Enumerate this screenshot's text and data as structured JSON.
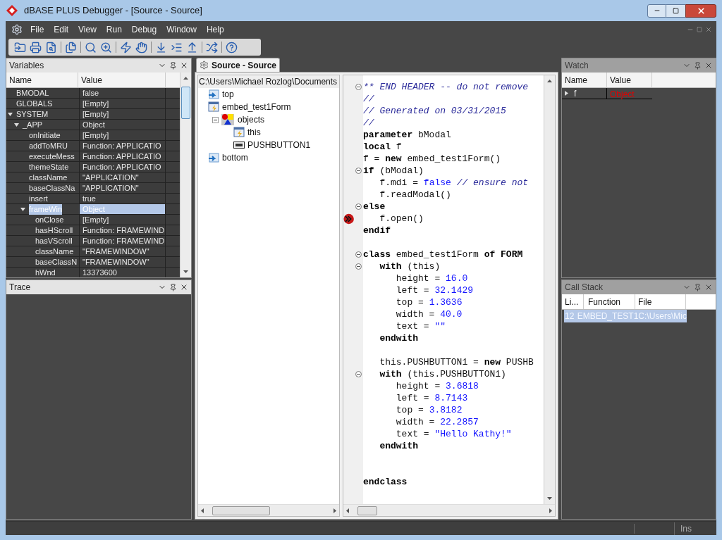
{
  "window": {
    "title": "dBASE PLUS Debugger - [Source - Source]"
  },
  "menu": [
    "File",
    "Edit",
    "View",
    "Run",
    "Debug",
    "Window",
    "Help"
  ],
  "variables": {
    "title": "Variables",
    "active": true,
    "columns": [
      "Name",
      "Value"
    ],
    "rows": [
      {
        "name": "BMODAL",
        "value": "false",
        "selected": false
      },
      {
        "name": "GLOBALS",
        "value": "[Empty]",
        "selected": false
      },
      {
        "name": "SYSTEM",
        "value": "[Empty]",
        "selected": false,
        "expanded": true,
        "children": [
          {
            "name": "_APP",
            "value": "Object",
            "selected": false,
            "expanded": true,
            "children": [
              {
                "name": "onInitiate",
                "value": "[Empty]",
                "selected": false
              },
              {
                "name": "addToMRU",
                "value": "Function: APPLICATIO",
                "selected": false
              },
              {
                "name": "executeMess",
                "value": "Function: APPLICATIO",
                "selected": false
              },
              {
                "name": "themeState",
                "value": "Function: APPLICATIO",
                "selected": false
              },
              {
                "name": "className",
                "value": "\"APPLICATION\"",
                "selected": false
              },
              {
                "name": "baseClassNa",
                "value": "\"APPLICATION\"",
                "selected": false
              },
              {
                "name": "insert",
                "value": "true",
                "selected": false
              },
              {
                "name": "frameWin",
                "value": "Object",
                "selected": true,
                "expanded": true,
                "children": [
                  {
                    "name": "onClose",
                    "value": "[Empty]",
                    "selected": false
                  },
                  {
                    "name": "hasHScroll",
                    "value": "Function: FRAMEWIND",
                    "selected": false
                  },
                  {
                    "name": "hasVScroll",
                    "value": "Function: FRAMEWIND",
                    "selected": false
                  },
                  {
                    "name": "className",
                    "value": "\"FRAMEWINDOW\"",
                    "selected": false
                  },
                  {
                    "name": "baseClassN",
                    "value": "\"FRAMEWINDOW\"",
                    "selected": false
                  },
                  {
                    "name": "hWnd",
                    "value": "13373600",
                    "selected": false
                  }
                ]
              }
            ]
          }
        ]
      }
    ]
  },
  "trace": {
    "title": "Trace",
    "active": true
  },
  "source": {
    "tab": "Source - Source",
    "path": "C:\\Users\\Michael Rozlog\\Documents",
    "tree": [
      {
        "kind": "page",
        "label": "top"
      },
      {
        "kind": "form",
        "label": "embed_test1Form",
        "children": [
          {
            "kind": "shapes",
            "label": "objects",
            "expanded": true,
            "children": [
              {
                "kind": "form",
                "label": "this"
              },
              {
                "kind": "button",
                "label": "PUSHBUTTON1"
              }
            ]
          }
        ]
      },
      {
        "kind": "page",
        "label": "bottom"
      }
    ],
    "code": [
      {
        "fold": true,
        "current": false,
        "segments": [
          {
            "kind": "comment",
            "text": "** END HEADER -- do not remove"
          }
        ]
      },
      {
        "fold": false,
        "current": false,
        "segments": [
          {
            "kind": "comment",
            "text": "//"
          }
        ]
      },
      {
        "fold": false,
        "current": false,
        "segments": [
          {
            "kind": "comment",
            "text": "// Generated on 03/31/2015"
          }
        ]
      },
      {
        "fold": false,
        "current": false,
        "segments": [
          {
            "kind": "comment",
            "text": "//"
          }
        ]
      },
      {
        "fold": false,
        "current": false,
        "segments": [
          {
            "kind": "keyword",
            "text": "parameter"
          },
          {
            "kind": "plain",
            "text": " bModal"
          }
        ]
      },
      {
        "fold": false,
        "current": false,
        "segments": [
          {
            "kind": "keyword",
            "text": "local"
          },
          {
            "kind": "plain",
            "text": " f"
          }
        ]
      },
      {
        "fold": false,
        "current": false,
        "segments": [
          {
            "kind": "plain",
            "text": "f = "
          },
          {
            "kind": "keyword",
            "text": "new"
          },
          {
            "kind": "plain",
            "text": " embed_test1Form()"
          }
        ]
      },
      {
        "fold": true,
        "current": false,
        "segments": [
          {
            "kind": "keyword",
            "text": "if"
          },
          {
            "kind": "plain",
            "text": " (bModal)"
          }
        ]
      },
      {
        "fold": false,
        "current": false,
        "segments": [
          {
            "kind": "plain",
            "text": "   f.mdi = "
          },
          {
            "kind": "literal",
            "text": "false"
          },
          {
            "kind": "comment",
            "text": " // ensure not"
          }
        ]
      },
      {
        "fold": false,
        "current": false,
        "segments": [
          {
            "kind": "plain",
            "text": "   f.readModal()"
          }
        ]
      },
      {
        "fold": true,
        "current": false,
        "segments": [
          {
            "kind": "keyword",
            "text": "else"
          }
        ]
      },
      {
        "fold": false,
        "current": true,
        "segments": [
          {
            "kind": "plain",
            "text": "   f.open()"
          }
        ]
      },
      {
        "fold": false,
        "current": false,
        "segments": [
          {
            "kind": "keyword",
            "text": "endif"
          }
        ]
      },
      {
        "kind": "blank"
      },
      {
        "fold": true,
        "current": false,
        "segments": [
          {
            "kind": "keyword",
            "text": "class"
          },
          {
            "kind": "plain",
            "text": " embed_test1Form "
          },
          {
            "kind": "keyword",
            "text": "of FORM"
          }
        ]
      },
      {
        "fold": true,
        "current": false,
        "segments": [
          {
            "kind": "keyword",
            "text": "   with"
          },
          {
            "kind": "plain",
            "text": " (this)"
          }
        ]
      },
      {
        "fold": false,
        "current": false,
        "segments": [
          {
            "kind": "plain",
            "text": "      height = "
          },
          {
            "kind": "literal",
            "text": "16.0"
          }
        ]
      },
      {
        "fold": false,
        "current": false,
        "segments": [
          {
            "kind": "plain",
            "text": "      left = "
          },
          {
            "kind": "literal",
            "text": "32.1429"
          }
        ]
      },
      {
        "fold": false,
        "current": false,
        "segments": [
          {
            "kind": "plain",
            "text": "      top = "
          },
          {
            "kind": "literal",
            "text": "1.3636"
          }
        ]
      },
      {
        "fold": false,
        "current": false,
        "segments": [
          {
            "kind": "plain",
            "text": "      width = "
          },
          {
            "kind": "literal",
            "text": "40.0"
          }
        ]
      },
      {
        "fold": false,
        "current": false,
        "segments": [
          {
            "kind": "plain",
            "text": "      text = "
          },
          {
            "kind": "literal",
            "text": "\"\""
          }
        ]
      },
      {
        "fold": false,
        "current": false,
        "segments": [
          {
            "kind": "keyword",
            "text": "   endwith"
          }
        ]
      },
      {
        "kind": "blank"
      },
      {
        "fold": false,
        "current": false,
        "segments": [
          {
            "kind": "plain",
            "text": "   this.PUSHBUTTON1 = "
          },
          {
            "kind": "keyword",
            "text": "new"
          },
          {
            "kind": "plain",
            "text": " PUSHB"
          }
        ]
      },
      {
        "fold": true,
        "current": false,
        "segments": [
          {
            "kind": "keyword",
            "text": "   with"
          },
          {
            "kind": "plain",
            "text": " (this.PUSHBUTTON1)"
          }
        ]
      },
      {
        "fold": false,
        "current": false,
        "segments": [
          {
            "kind": "plain",
            "text": "      height = "
          },
          {
            "kind": "literal",
            "text": "3.6818"
          }
        ]
      },
      {
        "fold": false,
        "current": false,
        "segments": [
          {
            "kind": "plain",
            "text": "      left = "
          },
          {
            "kind": "literal",
            "text": "8.7143"
          }
        ]
      },
      {
        "fold": false,
        "current": false,
        "segments": [
          {
            "kind": "plain",
            "text": "      top = "
          },
          {
            "kind": "literal",
            "text": "3.8182"
          }
        ]
      },
      {
        "fold": false,
        "current": false,
        "segments": [
          {
            "kind": "plain",
            "text": "      width = "
          },
          {
            "kind": "literal",
            "text": "22.2857"
          }
        ]
      },
      {
        "fold": false,
        "current": false,
        "segments": [
          {
            "kind": "plain",
            "text": "      text = "
          },
          {
            "kind": "literal",
            "text": "\"Hello Kathy!\""
          }
        ]
      },
      {
        "fold": false,
        "current": false,
        "segments": [
          {
            "kind": "keyword",
            "text": "   endwith"
          }
        ]
      },
      {
        "kind": "blank"
      },
      {
        "kind": "blank"
      },
      {
        "fold": false,
        "current": false,
        "segments": [
          {
            "kind": "keyword",
            "text": "endclass"
          }
        ]
      }
    ]
  },
  "watch": {
    "title": "Watch",
    "active": false,
    "columns": [
      "Name",
      "Value"
    ],
    "rows": [
      {
        "name": "f",
        "value": "Object",
        "expanded": false
      }
    ]
  },
  "call_stack": {
    "title": "Call Stack",
    "active": false,
    "columns": [
      "Li...",
      "Function",
      "File"
    ],
    "rows": [
      {
        "line": "12",
        "function": "EMBED_TEST1",
        "file": "C:\\Users\\Mic",
        "selected": true
      }
    ]
  },
  "status_bar": {
    "mode": "Ins"
  }
}
